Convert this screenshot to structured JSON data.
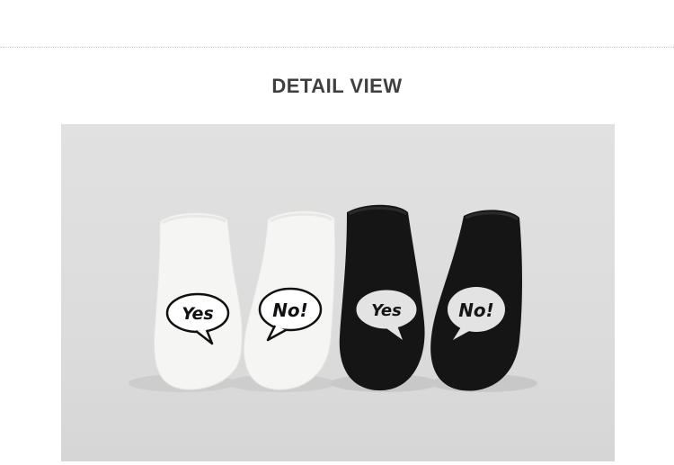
{
  "section": {
    "title": "DETAIL VIEW"
  },
  "photo": {
    "subject": "ankle-socks",
    "socks": [
      {
        "color": "#f4f4f2",
        "bubble_text": "Yes"
      },
      {
        "color": "#f4f4f2",
        "bubble_text": "No!"
      },
      {
        "color": "#151515",
        "bubble_text": "Yes"
      },
      {
        "color": "#151515",
        "bubble_text": "No!"
      }
    ]
  },
  "colors": {
    "title": "#3f3f3f",
    "photo_background": "#dcdcdc",
    "rule": "#cfcfcf"
  }
}
